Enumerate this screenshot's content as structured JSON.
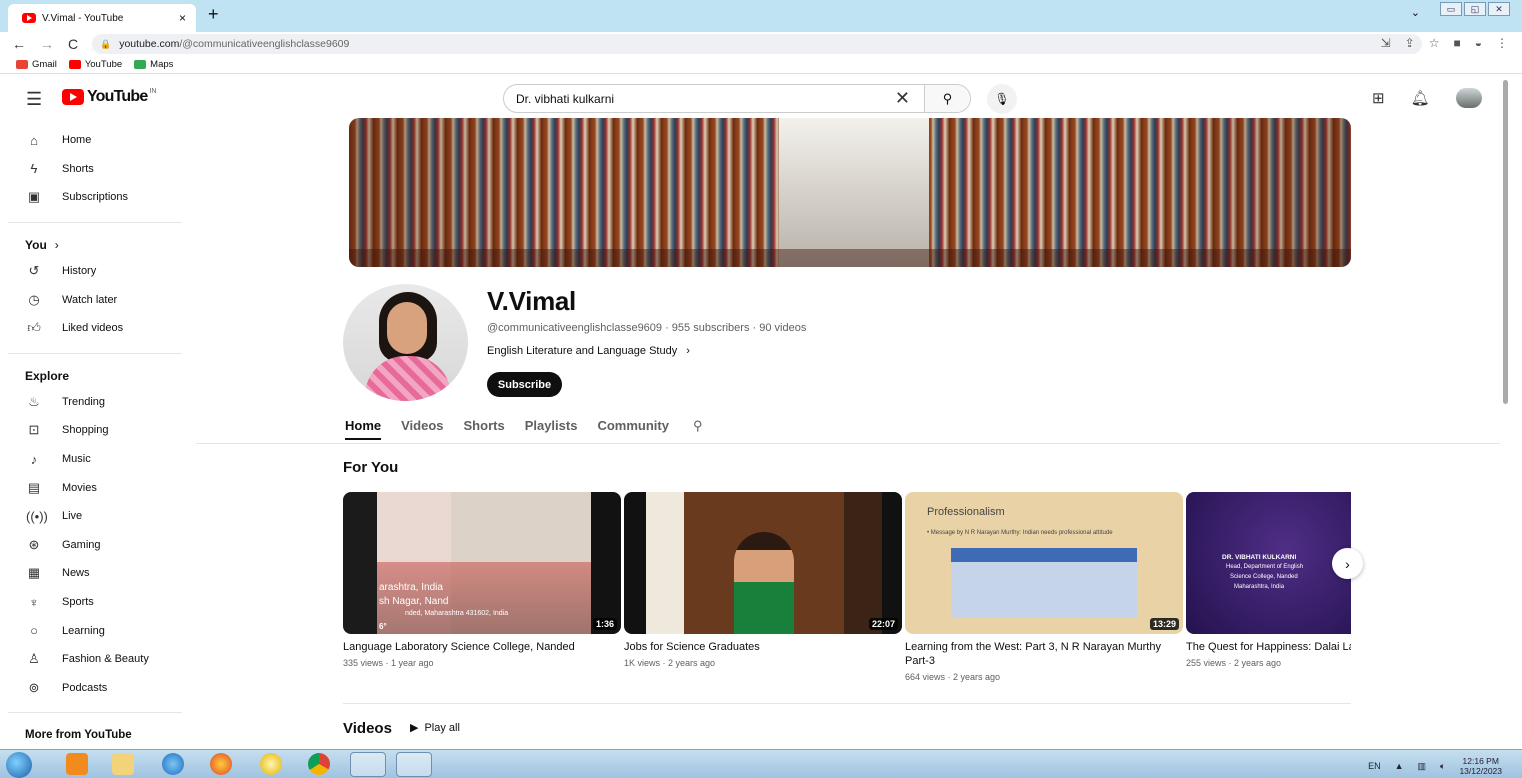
{
  "browser": {
    "tab_title": "V.Vimal - YouTube",
    "tab_close": "×",
    "new_tab": "+",
    "url_host": "youtube.com",
    "url_path": "/@communicativeenglishclasse9609",
    "bookmarks": [
      {
        "label": "Gmail",
        "color": "#ea4335"
      },
      {
        "label": "YouTube",
        "color": "#ff0000"
      },
      {
        "label": "Maps",
        "color": "#34a853"
      }
    ]
  },
  "masthead": {
    "logo_text": "YouTube",
    "country": "IN",
    "search_value": "Dr. vibhati kulkarni"
  },
  "sidebar": {
    "main": [
      {
        "label": "Home",
        "icon": "home-icon"
      },
      {
        "label": "Shorts",
        "icon": "shorts-icon"
      },
      {
        "label": "Subscriptions",
        "icon": "subscriptions-icon"
      }
    ],
    "you_heading": "You",
    "you_items": [
      {
        "label": "History",
        "icon": "history-icon"
      },
      {
        "label": "Watch later",
        "icon": "clock-icon"
      },
      {
        "label": "Liked videos",
        "icon": "thumbs-up-icon"
      }
    ],
    "explore_heading": "Explore",
    "explore_items": [
      {
        "label": "Trending",
        "icon": "trending-icon"
      },
      {
        "label": "Shopping",
        "icon": "bag-icon"
      },
      {
        "label": "Music",
        "icon": "music-icon"
      },
      {
        "label": "Movies",
        "icon": "clapper-icon"
      },
      {
        "label": "Live",
        "icon": "live-icon"
      },
      {
        "label": "Gaming",
        "icon": "gamepad-icon"
      },
      {
        "label": "News",
        "icon": "news-icon"
      },
      {
        "label": "Sports",
        "icon": "trophy-icon"
      },
      {
        "label": "Learning",
        "icon": "bulb-icon"
      },
      {
        "label": "Fashion & Beauty",
        "icon": "hanger-icon"
      },
      {
        "label": "Podcasts",
        "icon": "podcast-icon"
      }
    ],
    "more_heading": "More from YouTube"
  },
  "channel": {
    "name": "V.Vimal",
    "meta": "@communicativeenglishclasse9609 · 955 subscribers · 90 videos",
    "description": "English Literature and Language Study",
    "subscribe_label": "Subscribe",
    "tabs": [
      "Home",
      "Videos",
      "Shorts",
      "Playlists",
      "Community"
    ],
    "active_tab": "Home"
  },
  "for_you": {
    "heading": "For You",
    "videos": [
      {
        "title": "Language Laboratory Science College, Nanded",
        "meta": "335 views · 1 year ago",
        "duration": "1:36",
        "overlay": [
          "arashtra, India",
          "sh Nagar, Nand",
          "nded, Maharashtra 431602, India",
          "6°"
        ]
      },
      {
        "title": "Jobs for Science Graduates",
        "meta": "1K views · 2 years ago",
        "duration": "22:07"
      },
      {
        "title": "Learning from the West: Part 3, N R Narayan Murthy Part-3",
        "meta": "664 views · 2 years ago",
        "duration": "13:29",
        "overlay": [
          "Professionalism",
          "• Message by N R Narayan Murthy: Indian needs professional attitude"
        ]
      },
      {
        "title": "The Quest for Happiness: Dalai Lama",
        "meta": "255 views · 2 years ago",
        "duration": "",
        "overlay": [
          "DR. VIBHATI KULKARNI",
          "Head, Department of English",
          "Science College, Nanded",
          "Maharashtra, India"
        ]
      }
    ]
  },
  "videos_section": {
    "heading": "Videos",
    "play_all": "Play all"
  },
  "taskbar": {
    "lang": "EN",
    "time": "12:16 PM",
    "date": "13/12/2023"
  },
  "colors": {
    "yt_red": "#ff0000",
    "tabbar": "#bfe3f3",
    "subscribe_bg": "#0f0f0f"
  }
}
